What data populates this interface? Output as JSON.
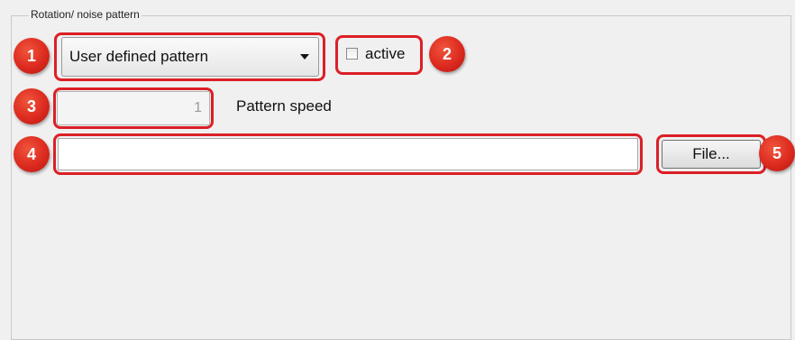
{
  "group": {
    "title": "Rotation/ noise pattern"
  },
  "pattern": {
    "selected": "User defined pattern"
  },
  "active": {
    "label": "active",
    "checked": false
  },
  "speed": {
    "value": "1",
    "label": "Pattern speed"
  },
  "file": {
    "path": "",
    "button_label": "File..."
  },
  "callouts": [
    "1",
    "2",
    "3",
    "4",
    "5"
  ],
  "colors": {
    "callout": "#dc1f26",
    "background": "#f0f0f0"
  }
}
